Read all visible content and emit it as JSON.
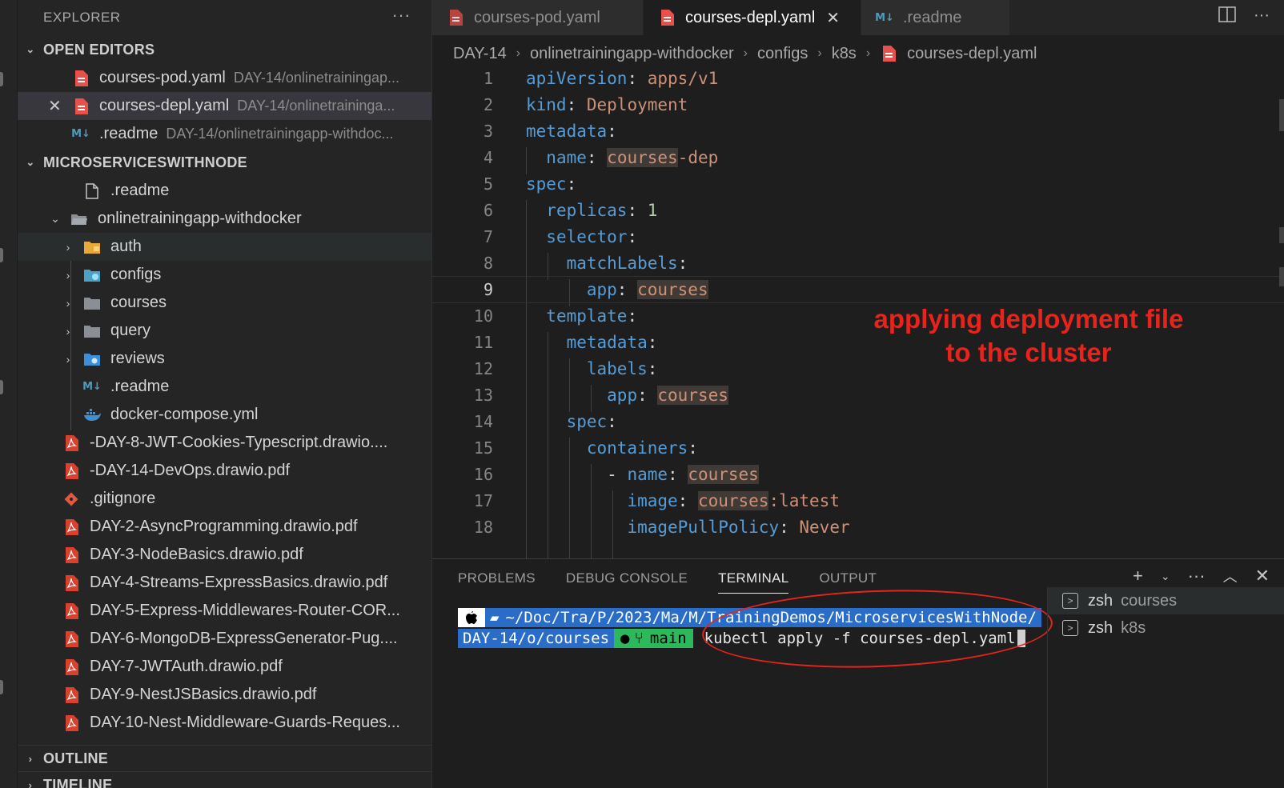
{
  "explorer": {
    "title": "EXPLORER",
    "more": "···",
    "open_editors_label": "OPEN EDITORS",
    "open_editors": [
      {
        "name": "courses-pod.yaml",
        "desc": "DAY-14/onlinetrainingap..."
      },
      {
        "name": "courses-depl.yaml",
        "desc": "DAY-14/onlinetraininga..."
      },
      {
        "name": ".readme",
        "desc": "DAY-14/onlinetrainingapp-withdoc..."
      }
    ],
    "workspace_label": "MICROSERVICESWITHNODE",
    "tree": [
      {
        "name": ".readme",
        "type": "file"
      },
      {
        "name": "onlinetrainingapp-withdocker",
        "type": "folder-open"
      },
      {
        "name": "auth",
        "type": "folder"
      },
      {
        "name": "configs",
        "type": "folder"
      },
      {
        "name": "courses",
        "type": "folder"
      },
      {
        "name": "query",
        "type": "folder"
      },
      {
        "name": "reviews",
        "type": "folder"
      },
      {
        "name": ".readme",
        "type": "md"
      },
      {
        "name": "docker-compose.yml",
        "type": "docker"
      },
      {
        "name": "-DAY-8-JWT-Cookies-Typescript.drawio....",
        "type": "pdf"
      },
      {
        "name": "-DAY-14-DevOps.drawio.pdf",
        "type": "pdf"
      },
      {
        "name": ".gitignore",
        "type": "git"
      },
      {
        "name": "DAY-2-AsyncProgramming.drawio.pdf",
        "type": "pdf"
      },
      {
        "name": "DAY-3-NodeBasics.drawio.pdf",
        "type": "pdf"
      },
      {
        "name": "DAY-4-Streams-ExpressBasics.drawio.pdf",
        "type": "pdf"
      },
      {
        "name": "DAY-5-Express-Middlewares-Router-COR...",
        "type": "pdf"
      },
      {
        "name": "DAY-6-MongoDB-ExpressGenerator-Pug....",
        "type": "pdf"
      },
      {
        "name": "DAY-7-JWTAuth.drawio.pdf",
        "type": "pdf"
      },
      {
        "name": "DAY-9-NestJSBasics.drawio.pdf",
        "type": "pdf"
      },
      {
        "name": "DAY-10-Nest-Middleware-Guards-Reques...",
        "type": "pdf"
      }
    ],
    "outline_label": "OUTLINE",
    "timeline_label": "TIMELINE"
  },
  "tabs": [
    {
      "label": "courses-pod.yaml"
    },
    {
      "label": "courses-depl.yaml"
    },
    {
      "label": ".readme"
    }
  ],
  "breadcrumb": [
    "DAY-14",
    "onlinetrainingapp-withdocker",
    "configs",
    "k8s",
    "courses-depl.yaml"
  ],
  "editor": {
    "line_numbers": [
      "1",
      "2",
      "3",
      "4",
      "5",
      "6",
      "7",
      "8",
      "9",
      "10",
      "11",
      "12",
      "13",
      "14",
      "15",
      "16",
      "17",
      "18"
    ],
    "tokens": {
      "l1k": "apiVersion",
      "l1v": "apps/v1",
      "l2k": "kind",
      "l2v": "Deployment",
      "l3k": "metadata",
      "l4k": "name",
      "l4h": "courses",
      "l4v": "-dep",
      "l5k": "spec",
      "l6k": "replicas",
      "l6v": "1",
      "l7k": "selector",
      "l8k": "matchLabels",
      "l9k": "app",
      "l9v": "courses",
      "l10k": "template",
      "l11k": "metadata",
      "l12k": "labels",
      "l13k": "app",
      "l13v": "courses",
      "l14k": "spec",
      "l15k": "containers",
      "l16d": "- ",
      "l16k": "name",
      "l16v": "courses",
      "l17k": "image",
      "l17h": "courses",
      "l17v": ":latest",
      "l18k": "imagePullPolicy",
      "l18v": "Never"
    }
  },
  "annotation": {
    "line1": "applying deployment file",
    "line2": "to the cluster"
  },
  "panel": {
    "tabs": [
      "PROBLEMS",
      "DEBUG CONSOLE",
      "TERMINAL",
      "OUTPUT"
    ],
    "prompt_path_1": "~/Doc/Tra/P/2023/Ma/M/TrainingDemos/MicroservicesWithNode/",
    "prompt_path_2": "DAY-14/o/courses",
    "git_branch": "main",
    "command": "kubectl apply -f courses-depl.yaml",
    "terminals": [
      {
        "shell": "zsh",
        "name": "courses"
      },
      {
        "shell": "zsh",
        "name": "k8s"
      }
    ]
  },
  "colors": {
    "annotation": "#e8231c",
    "keyword": "#569cd6",
    "string": "#ce9178"
  }
}
